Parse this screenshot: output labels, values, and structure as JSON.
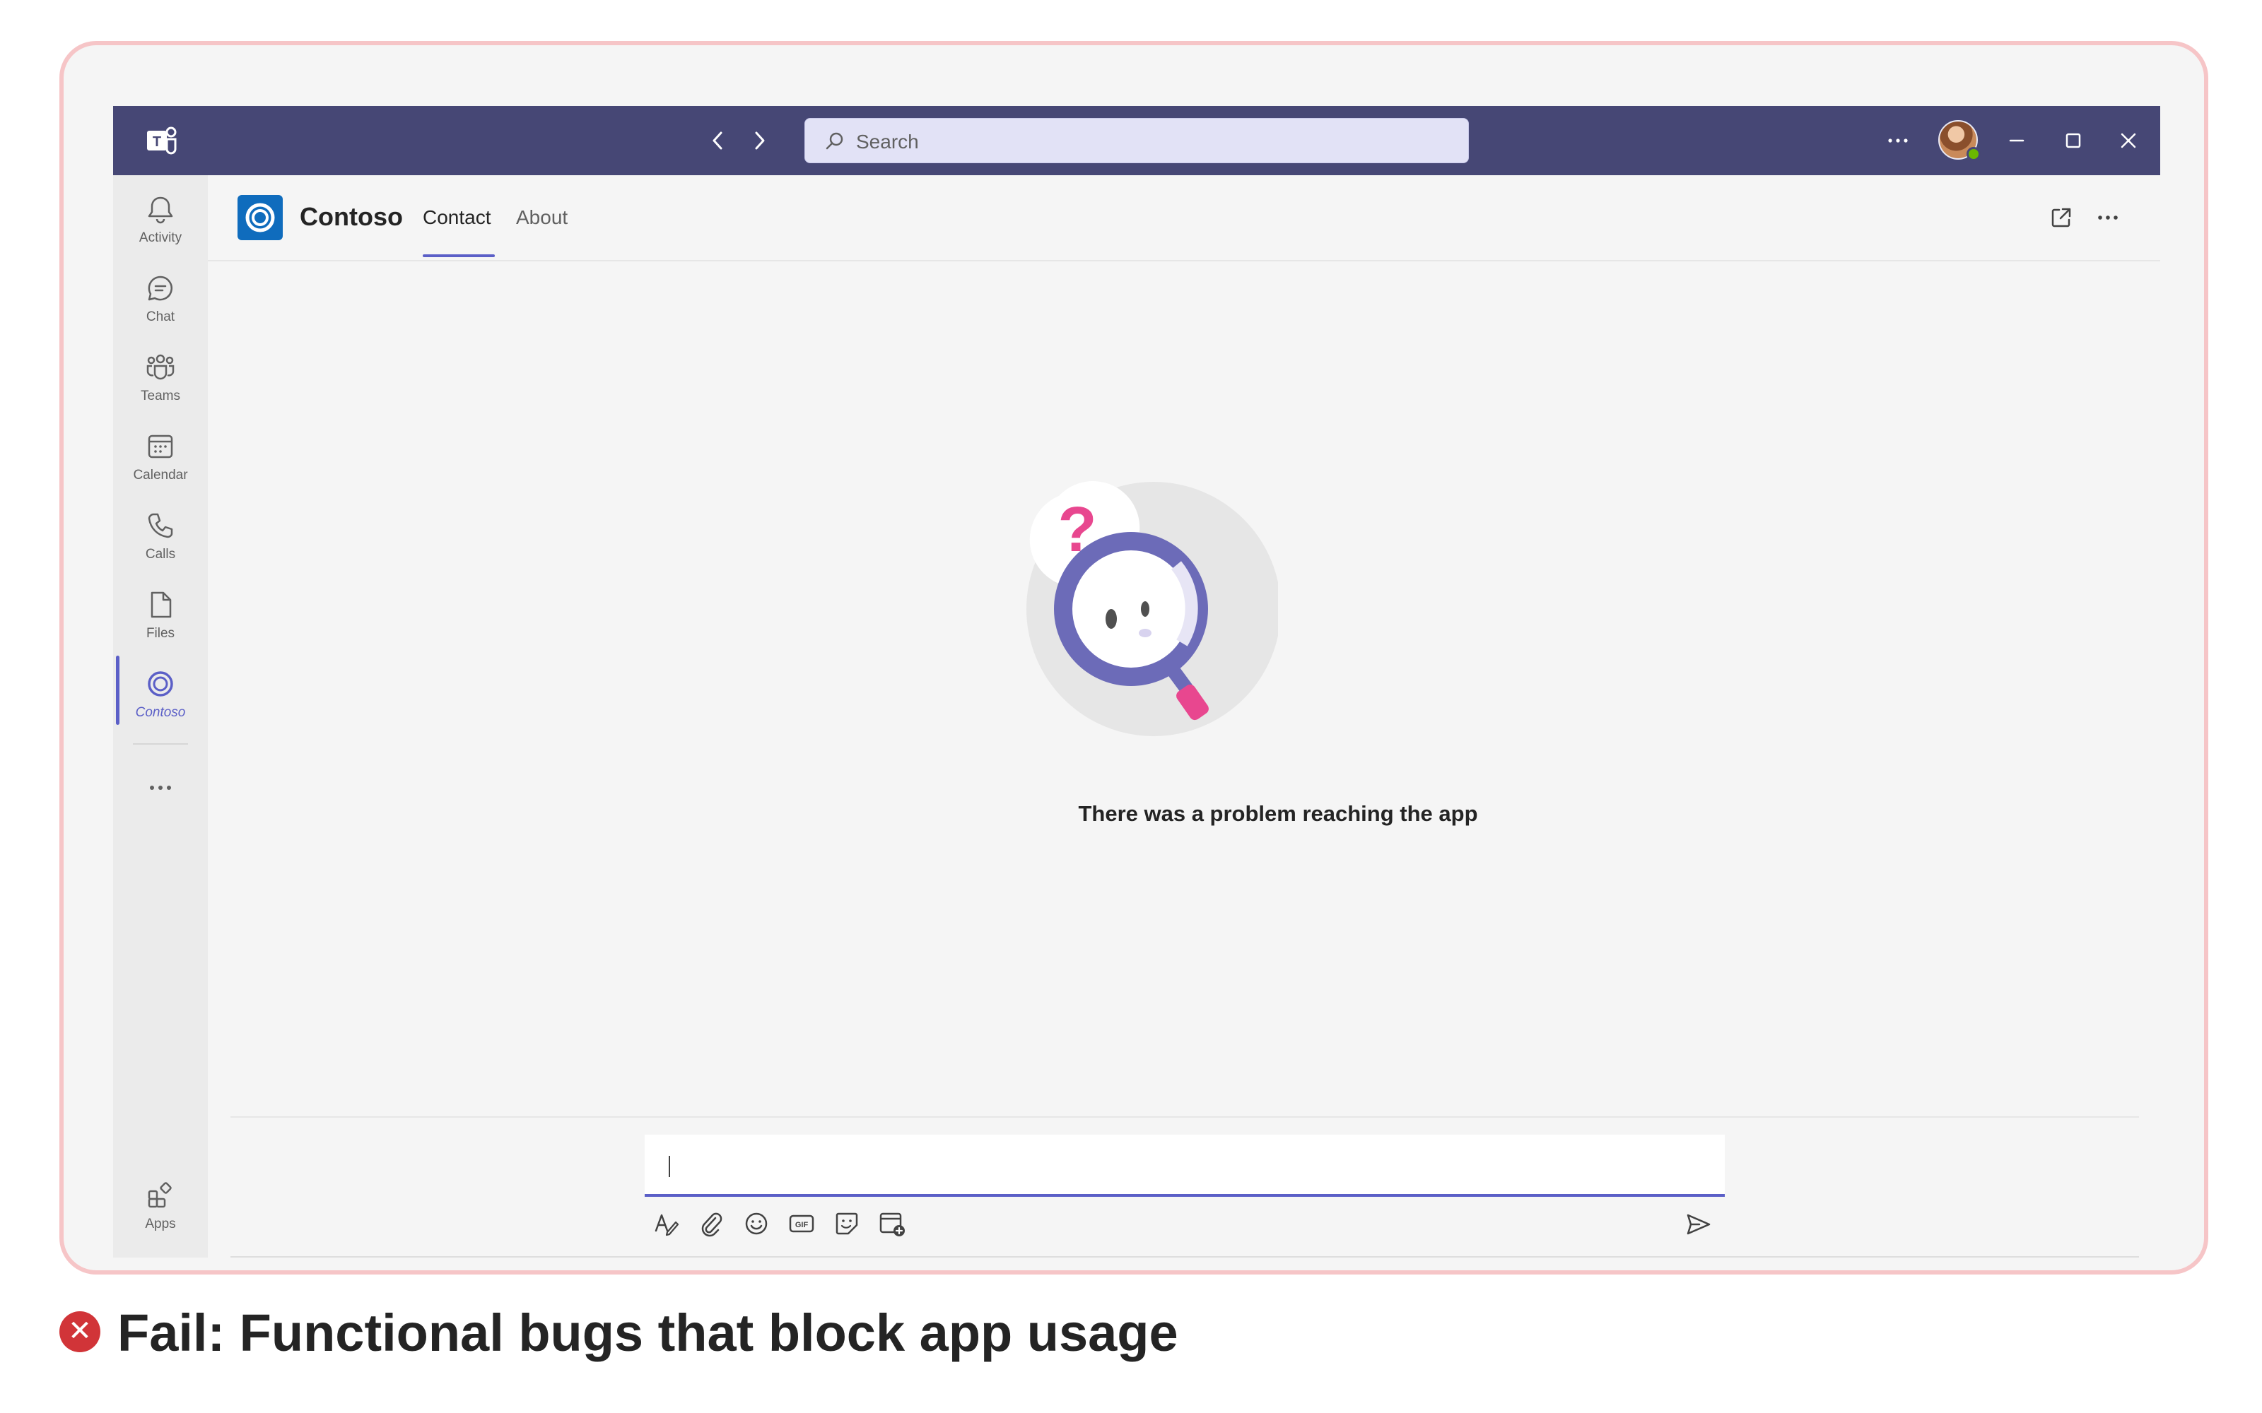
{
  "titlebar": {
    "search_placeholder": "Search"
  },
  "rail": {
    "items": [
      {
        "label": "Activity",
        "icon": "bell-icon"
      },
      {
        "label": "Chat",
        "icon": "chat-icon"
      },
      {
        "label": "Teams",
        "icon": "teams-icon"
      },
      {
        "label": "Calendar",
        "icon": "calendar-icon"
      },
      {
        "label": "Calls",
        "icon": "phone-icon"
      },
      {
        "label": "Files",
        "icon": "file-icon"
      },
      {
        "label": "Contoso",
        "icon": "contoso-icon",
        "active": true
      }
    ],
    "apps_label": "Apps"
  },
  "app": {
    "title": "Contoso",
    "tabs": [
      {
        "label": "Contact",
        "active": true
      },
      {
        "label": "About",
        "active": false
      }
    ]
  },
  "main": {
    "error_message": "There was a problem reaching the app"
  },
  "compose": {
    "tools": [
      "format-icon",
      "attach-icon",
      "emoji-icon",
      "gif-icon",
      "sticker-icon",
      "schedule-meeting-icon"
    ]
  },
  "caption": {
    "badge": "✕",
    "text": "Fail: Functional bugs that block app usage"
  },
  "colors": {
    "titlebar": "#464775",
    "accent": "#5b5fc7",
    "fail": "#d13438",
    "frame_border": "#f6c5c7"
  }
}
